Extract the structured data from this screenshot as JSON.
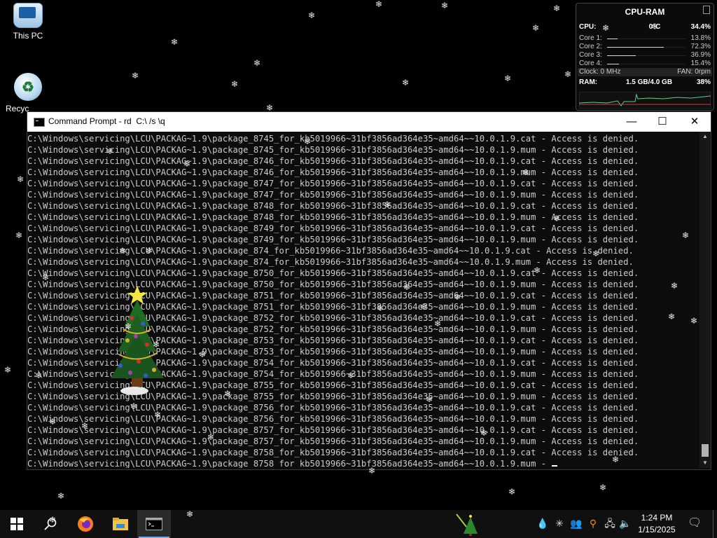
{
  "desktop": {
    "icons": [
      {
        "label": "This PC"
      },
      {
        "label": "Recyc"
      }
    ]
  },
  "gadget": {
    "title": "CPU-RAM",
    "cpu_label": "CPU:",
    "cpu_temp": "0°C",
    "cpu_value": "34.4%",
    "cores": [
      {
        "label": "Core 1:",
        "value": "13.8%",
        "level": 0.138
      },
      {
        "label": "Core 2:",
        "value": "72.3%",
        "level": 0.723
      },
      {
        "label": "Core 3:",
        "value": "36.9%",
        "level": 0.369
      },
      {
        "label": "Core 4:",
        "value": "15.4%",
        "level": 0.154
      }
    ],
    "clock": "Clock: 0 MHz",
    "fan": "FAN: 0rpm",
    "ram_label": "RAM:",
    "ram_usage": "1.5 GB/4.0 GB",
    "ram_percent": "38%"
  },
  "cmd": {
    "title": "Command Prompt - rd  C:\\ /s \\q",
    "minimize": "—",
    "maximize": "☐",
    "close": "✕",
    "lines": [
      "C:\\Windows\\servicing\\LCU\\PACKAG~1.9\\package_8745_for_kb5019966~31bf3856ad364e35~amd64~~10.0.1.9.cat - Access is denied.",
      "C:\\Windows\\servicing\\LCU\\PACKAG~1.9\\package_8745_for_kb5019966~31bf3856ad364e35~amd64~~10.0.1.9.mum - Access is denied.",
      "C:\\Windows\\servicing\\LCU\\PACKAG~1.9\\package_8746_for_kb5019966~31bf3856ad364e35~amd64~~10.0.1.9.cat - Access is denied.",
      "C:\\Windows\\servicing\\LCU\\PACKAG~1.9\\package_8746_for_kb5019966~31bf3856ad364e35~amd64~~10.0.1.9.mum - Access is denied.",
      "C:\\Windows\\servicing\\LCU\\PACKAG~1.9\\package_8747_for_kb5019966~31bf3856ad364e35~amd64~~10.0.1.9.cat - Access is denied.",
      "C:\\Windows\\servicing\\LCU\\PACKAG~1.9\\package_8747_for_kb5019966~31bf3856ad364e35~amd64~~10.0.1.9.mum - Access is denied.",
      "C:\\Windows\\servicing\\LCU\\PACKAG~1.9\\package_8748_for_kb5019966~31bf3856ad364e35~amd64~~10.0.1.9.cat - Access is denied.",
      "C:\\Windows\\servicing\\LCU\\PACKAG~1.9\\package_8748_for_kb5019966~31bf3856ad364e35~amd64~~10.0.1.9.mum - Access is denied.",
      "C:\\Windows\\servicing\\LCU\\PACKAG~1.9\\package_8749_for_kb5019966~31bf3856ad364e35~amd64~~10.0.1.9.cat - Access is denied.",
      "C:\\Windows\\servicing\\LCU\\PACKAG~1.9\\package_8749_for_kb5019966~31bf3856ad364e35~amd64~~10.0.1.9.mum - Access is denied.",
      "C:\\Windows\\servicing\\LCU\\PACKAG~1.9\\package_874_for_kb5019966~31bf3856ad364e35~amd64~~10.0.1.9.cat - Access is denied.",
      "C:\\Windows\\servicing\\LCU\\PACKAG~1.9\\package_874_for_kb5019966~31bf3856ad364e35~amd64~~10.0.1.9.mum - Access is denied.",
      "C:\\Windows\\servicing\\LCU\\PACKAG~1.9\\package_8750_for_kb5019966~31bf3856ad364e35~amd64~~10.0.1.9.cat - Access is denied.",
      "C:\\Windows\\servicing\\LCU\\PACKAG~1.9\\package_8750_for_kb5019966~31bf3856ad364e35~amd64~~10.0.1.9.mum - Access is denied.",
      "C:\\Windows\\servicing\\LCU\\PACKAG~1.9\\package_8751_for_kb5019966~31bf3856ad364e35~amd64~~10.0.1.9.cat - Access is denied.",
      "C:\\Windows\\servicing\\LCU\\PACKAG~1.9\\package_8751_for_kb5019966~31bf3856ad364e35~amd64~~10.0.1.9.mum - Access is denied.",
      "C:\\Windows\\servicing\\LCU\\PACKAG~1.9\\package_8752_for_kb5019966~31bf3856ad364e35~amd64~~10.0.1.9.cat - Access is denied.",
      "C:\\Windows\\servicing\\LCU\\PACKAG~1.9\\package_8752_for_kb5019966~31bf3856ad364e35~amd64~~10.0.1.9.mum - Access is denied.",
      "C:\\Windows\\servicing\\LCU\\PACKAG~1.9\\package_8753_for_kb5019966~31bf3856ad364e35~amd64~~10.0.1.9.cat - Access is denied.",
      "C:\\Windows\\servicing\\LCU\\PACKAG~1.9\\package_8753_for_kb5019966~31bf3856ad364e35~amd64~~10.0.1.9.mum - Access is denied.",
      "C:\\Windows\\servicing\\LCU\\PACKAG~1.9\\package_8754_for_kb5019966~31bf3856ad364e35~amd64~~10.0.1.9.cat - Access is denied.",
      "C:\\Windows\\servicing\\LCU\\PACKAG~1.9\\package_8754_for_kb5019966~31bf3856ad364e35~amd64~~10.0.1.9.mum - Access is denied.",
      "C:\\Windows\\servicing\\LCU\\PACKAG~1.9\\package_8755_for_kb5019966~31bf3856ad364e35~amd64~~10.0.1.9.cat - Access is denied.",
      "C:\\Windows\\servicing\\LCU\\PACKAG~1.9\\package_8755_for_kb5019966~31bf3856ad364e35~amd64~~10.0.1.9.mum - Access is denied.",
      "C:\\Windows\\servicing\\LCU\\PACKAG~1.9\\package_8756_for_kb5019966~31bf3856ad364e35~amd64~~10.0.1.9.cat - Access is denied.",
      "C:\\Windows\\servicing\\LCU\\PACKAG~1.9\\package_8756_for_kb5019966~31bf3856ad364e35~amd64~~10.0.1.9.mum - Access is denied.",
      "C:\\Windows\\servicing\\LCU\\PACKAG~1.9\\package_8757_for_kb5019966~31bf3856ad364e35~amd64~~10.0.1.9.cat - Access is denied.",
      "C:\\Windows\\servicing\\LCU\\PACKAG~1.9\\package_8757_for_kb5019966~31bf3856ad364e35~amd64~~10.0.1.9.mum - Access is denied.",
      "C:\\Windows\\servicing\\LCU\\PACKAG~1.9\\package_8758_for_kb5019966~31bf3856ad364e35~amd64~~10.0.1.9.cat - Access is denied.",
      "C:\\Windows\\servicing\\LCU\\PACKAG~1.9\\package_8758_for_kb5019966~31bf3856ad364e35~amd64~~10.0.1.9.mum -"
    ]
  },
  "taskbar": {
    "buttons": [
      {
        "icon": "windows-start-icon"
      },
      {
        "icon": "search-icon"
      },
      {
        "icon": "firefox-icon"
      },
      {
        "icon": "file-explorer-icon"
      },
      {
        "icon": "command-prompt-icon"
      }
    ],
    "tray": [
      {
        "icon": "water-drop-icon"
      },
      {
        "icon": "snowflake-icon"
      },
      {
        "icon": "people-icon"
      },
      {
        "icon": "key-icon"
      },
      {
        "icon": "network-icon"
      },
      {
        "icon": "volume-icon"
      }
    ],
    "time": "1:24 PM",
    "date": "1/15/2025"
  },
  "colors": {
    "console_bg": "#0c0c0c",
    "console_text": "#cccccc",
    "taskbar_bg": "#101010",
    "accent": "#78a9e0"
  }
}
